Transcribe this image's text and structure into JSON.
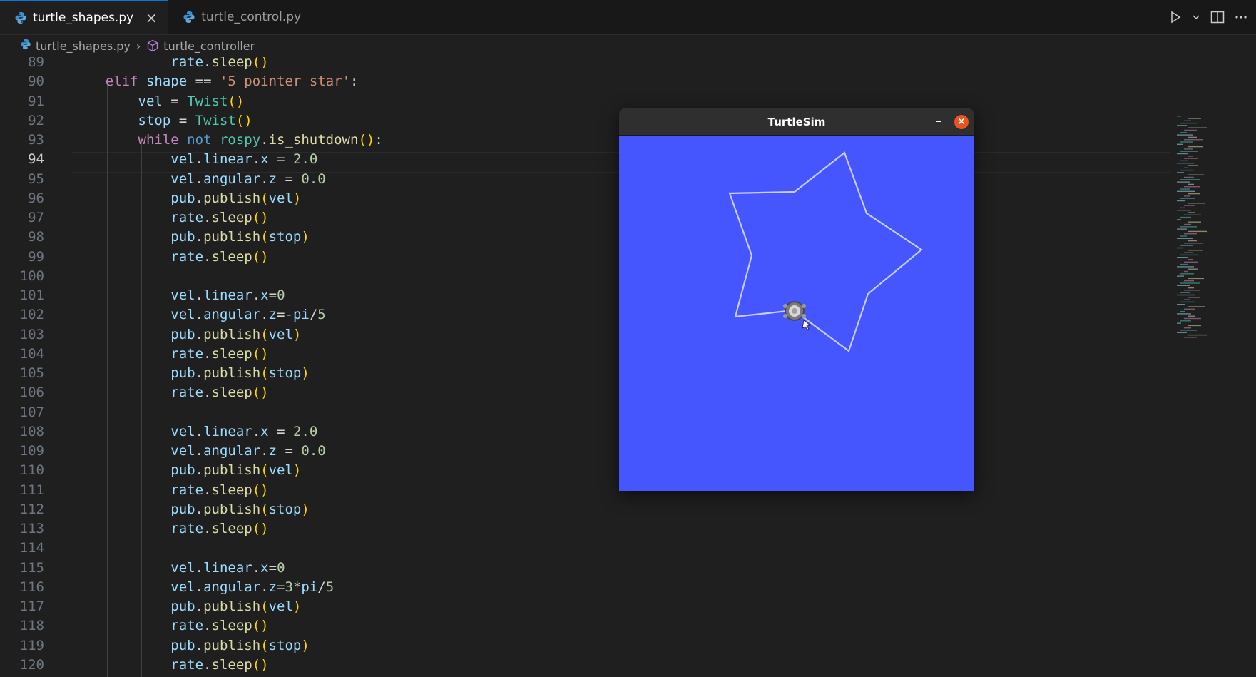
{
  "tabs": [
    {
      "label": "turtle_shapes.py",
      "active": true,
      "icon": "python-icon"
    },
    {
      "label": "turtle_control.py",
      "active": false,
      "icon": "python-icon"
    }
  ],
  "tab_actions": {
    "run": "run-icon",
    "run_menu": "chevron-down-icon",
    "split": "split-editor-icon",
    "more": "more-icon"
  },
  "breadcrumb": {
    "file": "turtle_shapes.py",
    "symbol": "turtle_controller"
  },
  "editor": {
    "current_line": 94,
    "lines": [
      {
        "n": "89",
        "indent": 3,
        "code": "rate.sleep()"
      },
      {
        "n": "90",
        "indent": 1,
        "code": "elif shape == '5 pointer star':"
      },
      {
        "n": "91",
        "indent": 2,
        "code": "vel = Twist()"
      },
      {
        "n": "92",
        "indent": 2,
        "code": "stop = Twist()"
      },
      {
        "n": "93",
        "indent": 2,
        "code": "while not rospy.is_shutdown():"
      },
      {
        "n": "94",
        "indent": 3,
        "code": "vel.linear.x = 2.0"
      },
      {
        "n": "95",
        "indent": 3,
        "code": "vel.angular.z = 0.0"
      },
      {
        "n": "96",
        "indent": 3,
        "code": "pub.publish(vel)"
      },
      {
        "n": "97",
        "indent": 3,
        "code": "rate.sleep()"
      },
      {
        "n": "98",
        "indent": 3,
        "code": "pub.publish(stop)"
      },
      {
        "n": "99",
        "indent": 3,
        "code": "rate.sleep()"
      },
      {
        "n": "100",
        "indent": 0,
        "code": ""
      },
      {
        "n": "101",
        "indent": 3,
        "code": "vel.linear.x=0"
      },
      {
        "n": "102",
        "indent": 3,
        "code": "vel.angular.z=-pi/5"
      },
      {
        "n": "103",
        "indent": 3,
        "code": "pub.publish(vel)"
      },
      {
        "n": "104",
        "indent": 3,
        "code": "rate.sleep()"
      },
      {
        "n": "105",
        "indent": 3,
        "code": "pub.publish(stop)"
      },
      {
        "n": "106",
        "indent": 3,
        "code": "rate.sleep()"
      },
      {
        "n": "107",
        "indent": 0,
        "code": ""
      },
      {
        "n": "108",
        "indent": 3,
        "code": "vel.linear.x = 2.0"
      },
      {
        "n": "109",
        "indent": 3,
        "code": "vel.angular.z = 0.0"
      },
      {
        "n": "110",
        "indent": 3,
        "code": "pub.publish(vel)"
      },
      {
        "n": "111",
        "indent": 3,
        "code": "rate.sleep()"
      },
      {
        "n": "112",
        "indent": 3,
        "code": "pub.publish(stop)"
      },
      {
        "n": "113",
        "indent": 3,
        "code": "rate.sleep()"
      },
      {
        "n": "114",
        "indent": 0,
        "code": ""
      },
      {
        "n": "115",
        "indent": 3,
        "code": "vel.linear.x=0"
      },
      {
        "n": "116",
        "indent": 3,
        "code": "vel.angular.z=3*pi/5"
      },
      {
        "n": "117",
        "indent": 3,
        "code": "pub.publish(vel)"
      },
      {
        "n": "118",
        "indent": 3,
        "code": "rate.sleep()"
      },
      {
        "n": "119",
        "indent": 3,
        "code": "pub.publish(stop)"
      },
      {
        "n": "120",
        "indent": 3,
        "code": "rate.sleep()"
      }
    ]
  },
  "turtlesim": {
    "title": "TurtleSim",
    "minimize_label": "–",
    "close_label": "×",
    "background_color": "#4556ff",
    "path_color": "#c8ccff"
  },
  "colors": {
    "accent": "#0078d4",
    "close_button": "#e95420"
  }
}
